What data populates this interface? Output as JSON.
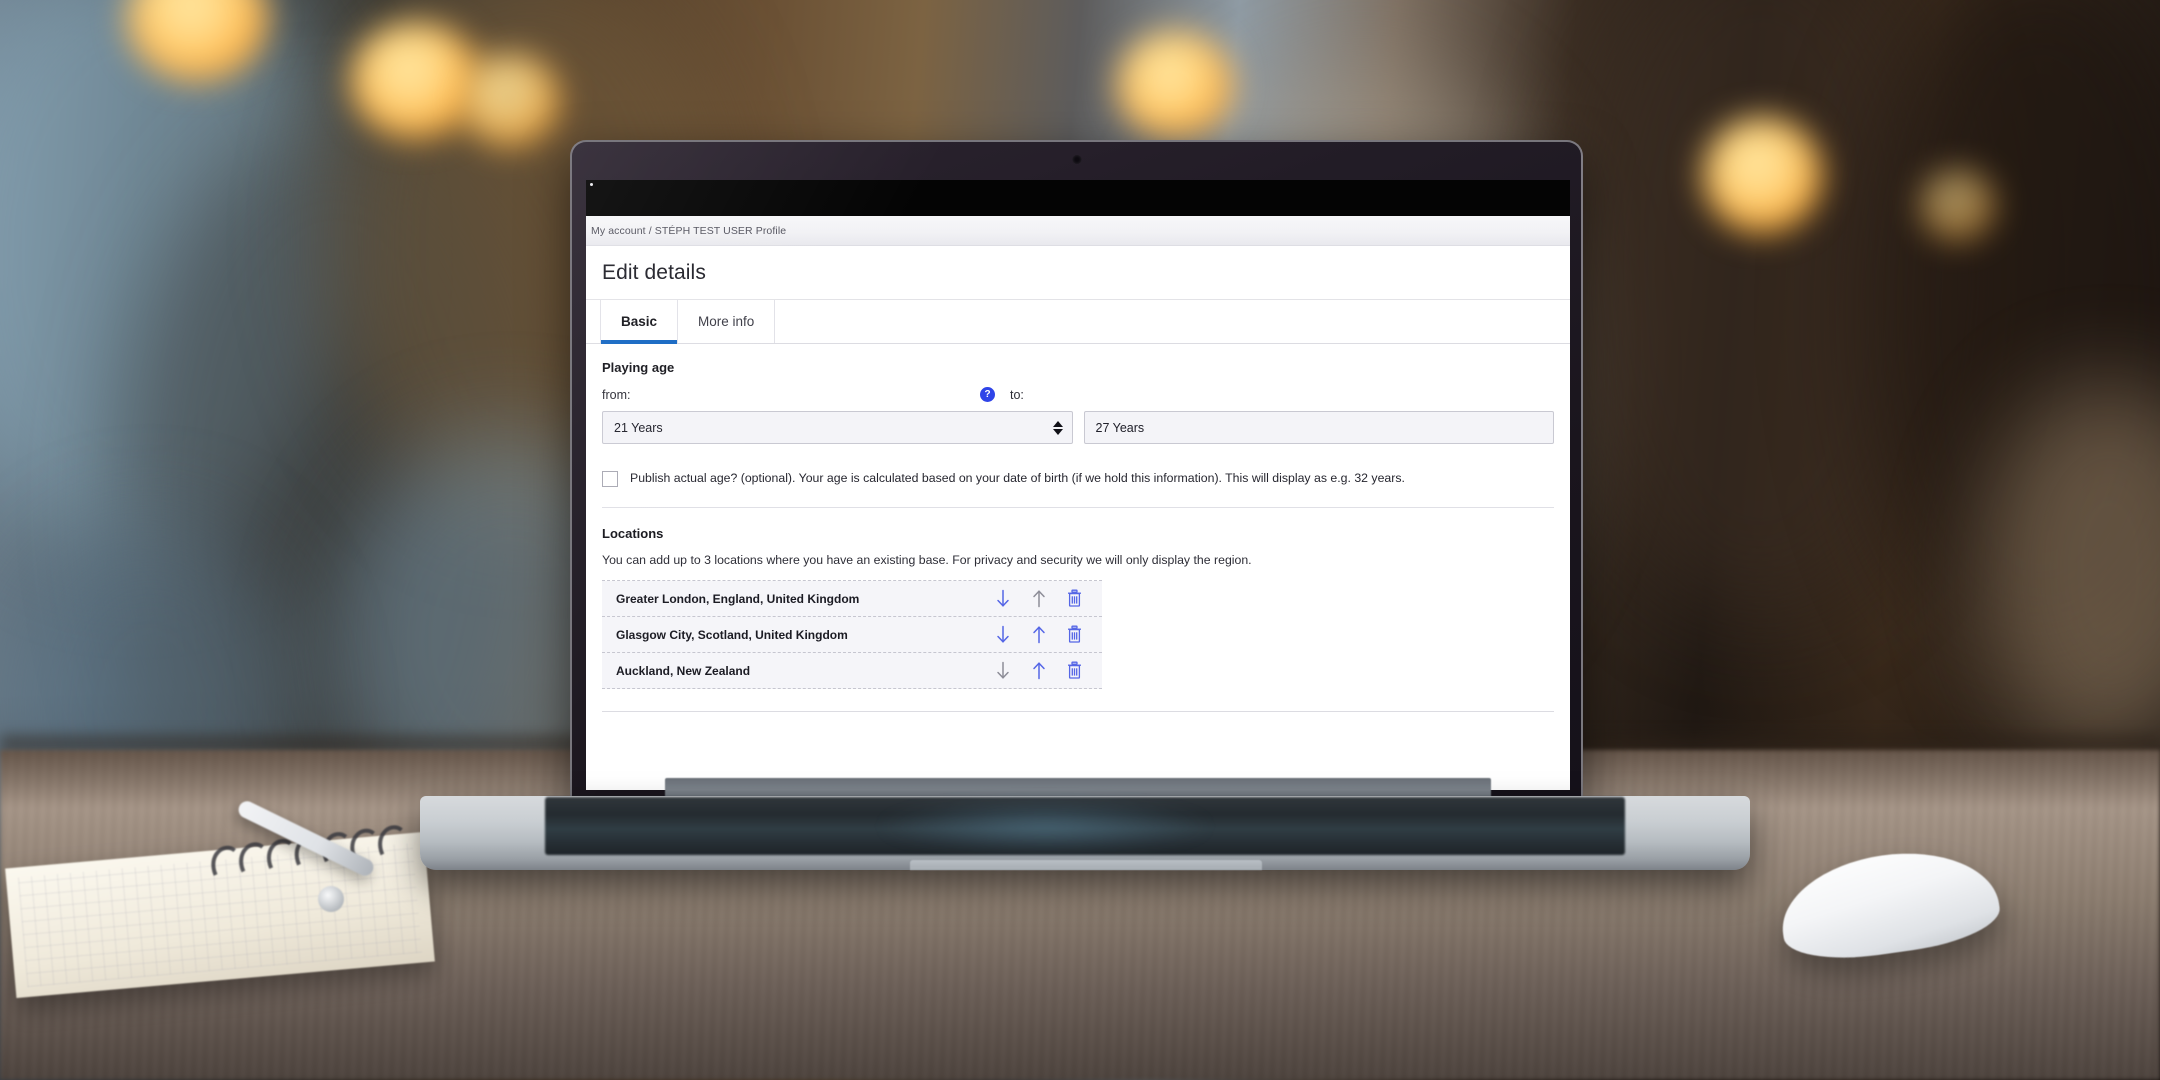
{
  "breadcrumb": {
    "text": "My account / STÉPH TEST USER Profile"
  },
  "page": {
    "title": "Edit details"
  },
  "tabs": [
    {
      "label": "Basic",
      "active": true
    },
    {
      "label": "More info",
      "active": false
    }
  ],
  "playing_age": {
    "section_title": "Playing age",
    "from_label": "from:",
    "to_label": "to:",
    "help_glyph": "?",
    "from_value": "21 Years",
    "to_value": "27 Years"
  },
  "publish_age": {
    "checked": true,
    "checkbox_color": "#4fe0b0",
    "text": "Publish actual age? (optional). Your age is calculated based on your date of birth (if we hold this information). This will display as e.g. 32 years."
  },
  "locations": {
    "section_title": "Locations",
    "description": "You can add up to 3 locations where you have an existing base. For privacy and security we will only display the region.",
    "rows": [
      {
        "name": "Greater London, England, United Kingdom",
        "down_enabled": true,
        "up_enabled": false
      },
      {
        "name": "Glasgow City, Scotland, United Kingdom",
        "down_enabled": true,
        "up_enabled": true
      },
      {
        "name": "Auckland, New Zealand",
        "down_enabled": false,
        "up_enabled": true
      }
    ]
  },
  "colors": {
    "accent_tab_underline": "#1668c3",
    "help_icon_blue": "#2f44e8",
    "action_blue": "#5566e6",
    "action_disabled_grey": "#8d8d98",
    "checkbox_teal": "#4fe0b0"
  }
}
